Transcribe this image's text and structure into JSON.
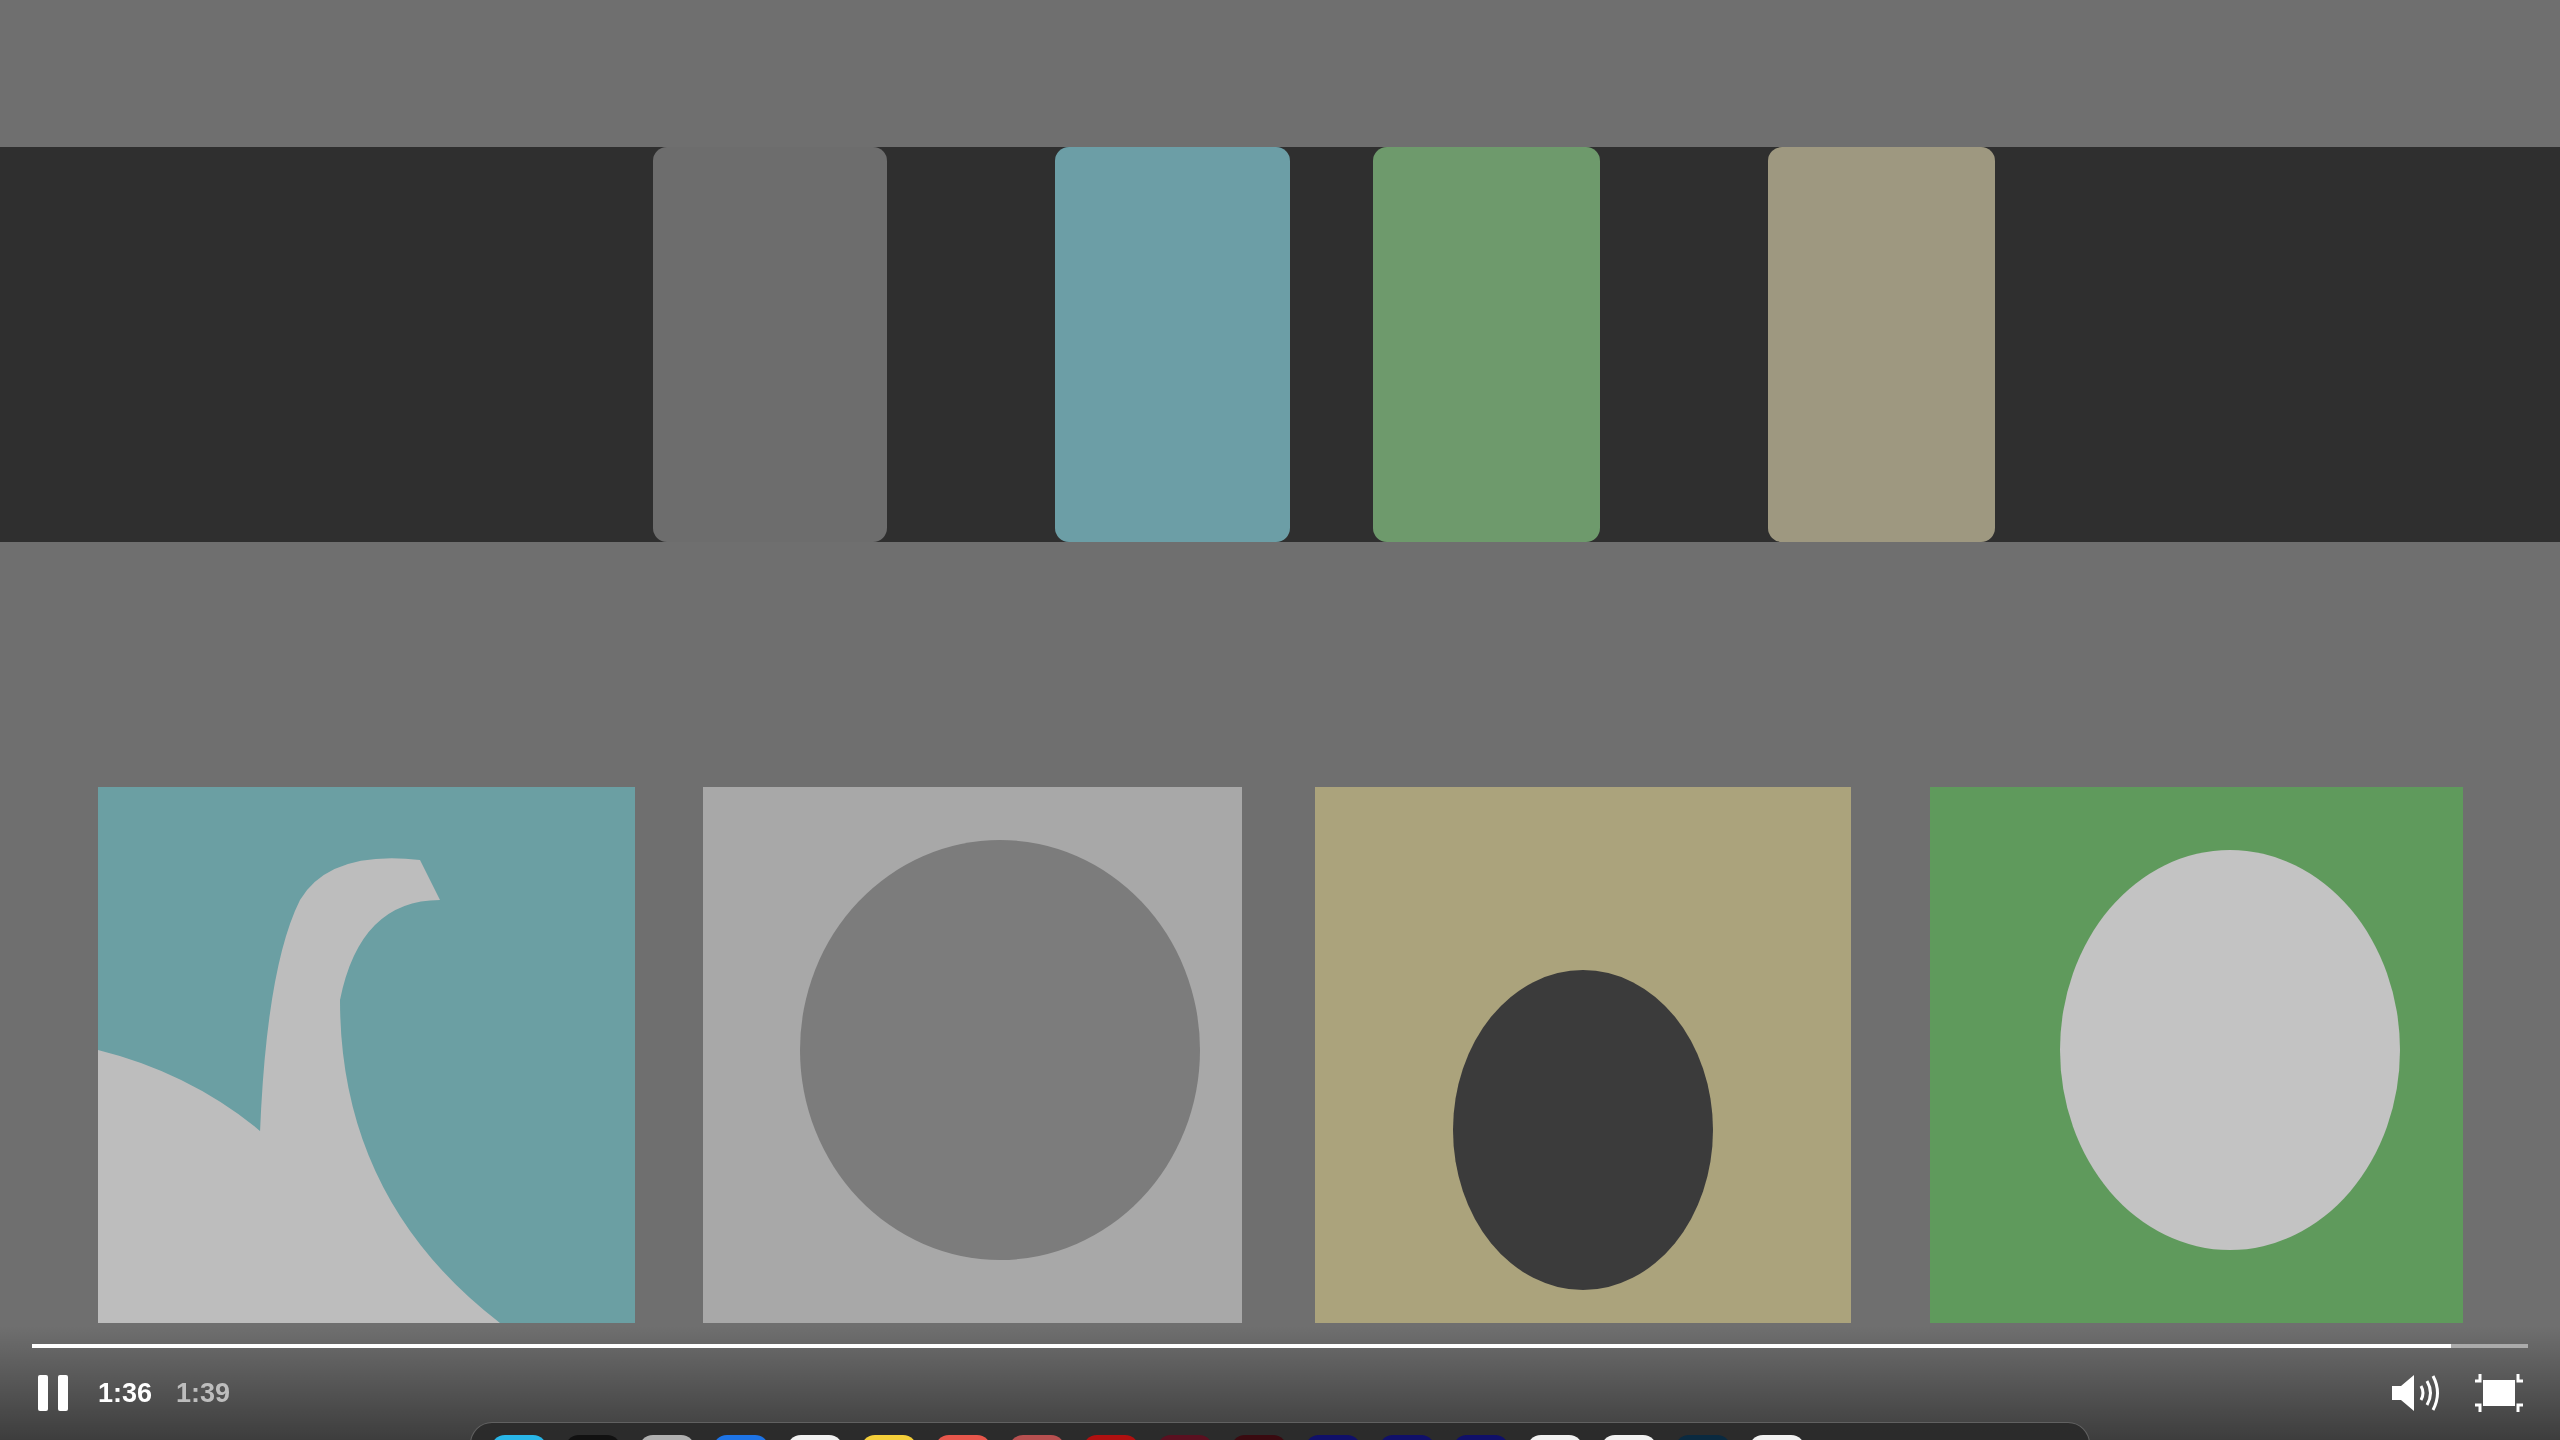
{
  "player": {
    "playing": true,
    "progress": {
      "level": 0.969
    },
    "current_time": "1:36",
    "duration": "1:39"
  },
  "dock": {
    "apps": [
      {
        "color": "#29b6e8"
      },
      {
        "color": "#111111"
      },
      {
        "color": "#b0b0b0"
      },
      {
        "color": "#1e74e6"
      },
      {
        "color": "#f2f2f2"
      },
      {
        "color": "#f5cf3a"
      },
      {
        "color": "#e8574c"
      },
      {
        "color": "#b85050"
      },
      {
        "color": "#b01010"
      },
      {
        "color": "#5a1020"
      },
      {
        "color": "#3a0a10"
      },
      {
        "color": "#10106a"
      },
      {
        "color": "#10106a"
      },
      {
        "color": "#10106a"
      },
      {
        "color": "#f2f2f2"
      },
      {
        "color": "#f2f2f2"
      },
      {
        "color": "#0a2a40"
      },
      {
        "color": "#f2f2f2"
      }
    ]
  }
}
